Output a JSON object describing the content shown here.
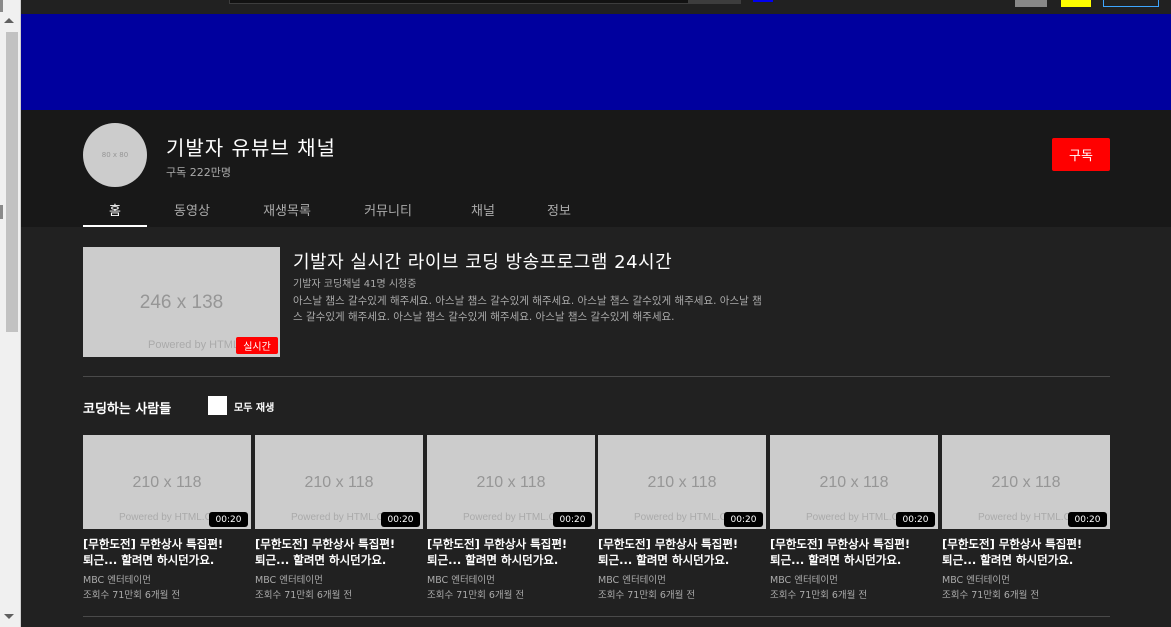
{
  "channel": {
    "avatar_text": "80 x 80",
    "name": "기발자 유뷰브 채널",
    "subscribers": "구독 222만명",
    "subscribe_label": "구독"
  },
  "tabs": [
    {
      "label": "홈",
      "active": true
    },
    {
      "label": "동영상"
    },
    {
      "label": "재생목록"
    },
    {
      "label": "커뮤니티"
    },
    {
      "label": "채널"
    },
    {
      "label": "정보"
    }
  ],
  "featured": {
    "thumb_text": "246 x 138",
    "thumb_watermark": "Powered by HTML.COM",
    "live_badge": "실시간",
    "title": "기발자 실시간 라이브 코딩 방송프로그램 24시간",
    "meta": "기발자 코딩채널 41명 시청중",
    "description": "아스날 챔스 갈수있게 해주세요. 아스날 챔스 갈수있게 해주세요. 아스날 챔스 갈수있게 해주세요. 아스날 챔스 갈수있게 해주세요. 아스날 챔스 갈수있게 해주세요. 아스날 챔스 갈수있게 해주세요."
  },
  "shelf": {
    "title": "코딩하는 사람들",
    "play_all_label": "모두 재생"
  },
  "videos": [
    {
      "thumb_text": "210 x 118",
      "watermark": "Powered by HTML.COM",
      "duration": "00:20",
      "title_line1": "[무한도전] 무한상사 특집편!",
      "title_line2": "퇴근... 할려면 하시던가요.",
      "channel": "MBC 엔터테이먼",
      "stats": "조회수 71만회 6개월 전"
    },
    {
      "thumb_text": "210 x 118",
      "watermark": "Powered by HTML.COM",
      "duration": "00:20",
      "title_line1": "[무한도전] 무한상사 특집편!",
      "title_line2": "퇴근... 할려면 하시던가요.",
      "channel": "MBC 엔터테이먼",
      "stats": "조회수 71만회 6개월 전"
    },
    {
      "thumb_text": "210 x 118",
      "watermark": "Powered by HTML.COM",
      "duration": "00:20",
      "title_line1": "[무한도전] 무한상사 특집편!",
      "title_line2": "퇴근... 할려면 하시던가요.",
      "channel": "MBC 엔터테이먼",
      "stats": "조회수 71만회 6개월 전"
    },
    {
      "thumb_text": "210 x 118",
      "watermark": "Powered by HTML.COM",
      "duration": "00:20",
      "title_line1": "[무한도전] 무한상사 특집편!",
      "title_line2": "퇴근... 할려면 하시던가요.",
      "channel": "MBC 엔터테이먼",
      "stats": "조회수 71만회 6개월 전"
    },
    {
      "thumb_text": "210 x 118",
      "watermark": "Powered by HTML.COM",
      "duration": "00:20",
      "title_line1": "[무한도전] 무한상사 특집편!",
      "title_line2": "퇴근... 할려면 하시던가요.",
      "channel": "MBC 엔터테이먼",
      "stats": "조회수 71만회 6개월 전"
    },
    {
      "thumb_text": "210 x 118",
      "watermark": "Powered by HTML.COM",
      "duration": "00:20",
      "title_line1": "[무한도전] 무한상사 특집편!",
      "title_line2": "퇴근... 할려면 하시던가요.",
      "channel": "MBC 엔터테이먼",
      "stats": "조회수 71만회 6개월 전"
    }
  ],
  "colors": {
    "background": "#212121",
    "header_background": "#181818",
    "banner": "#00009e",
    "accent_red": "#ff0000",
    "thumbnail_placeholder": "#cccccc"
  }
}
